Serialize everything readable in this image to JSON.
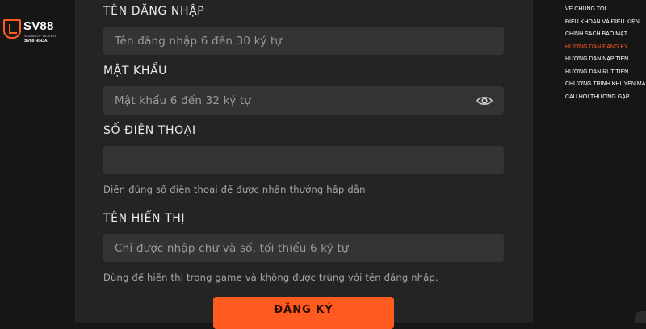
{
  "brand": {
    "name": "SV88",
    "tagline": "SOUND OF VICTORY",
    "site": "SV88 NINJA",
    "accent_color": "#ff5a1f"
  },
  "form": {
    "username": {
      "label": "TÊN ĐĂNG NHẬP",
      "value": "",
      "placeholder": "Tên đăng nhập 6 đến 30 ký tự"
    },
    "password": {
      "label": "MẬT KHẨU",
      "value": "",
      "placeholder": "Mật khẩu 6 đến 32 ký tự",
      "toggle_icon": "eye-icon"
    },
    "phone": {
      "label": "SỐ ĐIỆN THOẠI",
      "value": "",
      "placeholder": "",
      "hint": "Điền đúng số điện thoại để được nhận thưởng hấp dẫn"
    },
    "display_name": {
      "label": "TÊN HIỂN THỊ",
      "value": "",
      "placeholder": "Chỉ được nhập chữ và số, tối thiểu 6 ký tự",
      "hint": "Dùng để hiển thị trong game và không được trùng với tên đăng nhập."
    },
    "submit_label": "ĐĂNG KÝ"
  },
  "side_menu": {
    "items": [
      {
        "label": "VỀ CHÚNG TÔI",
        "active": false
      },
      {
        "label": "ĐIỀU KHOẢN VÀ ĐIỀU KIỆN",
        "active": false
      },
      {
        "label": "CHÍNH SÁCH BẢO MẬT",
        "active": false
      },
      {
        "label": "HƯỚNG DẪN ĐĂNG KÝ",
        "active": true
      },
      {
        "label": "HƯỚNG DẪN NẠP TIỀN",
        "active": false
      },
      {
        "label": "HƯỚNG DẪN RÚT TIỀN",
        "active": false
      },
      {
        "label": "CHƯƠNG TRÌNH KHUYẾN MÃI",
        "active": false
      },
      {
        "label": "CÂU HỎI THƯỜNG GẶP",
        "active": false
      }
    ]
  }
}
